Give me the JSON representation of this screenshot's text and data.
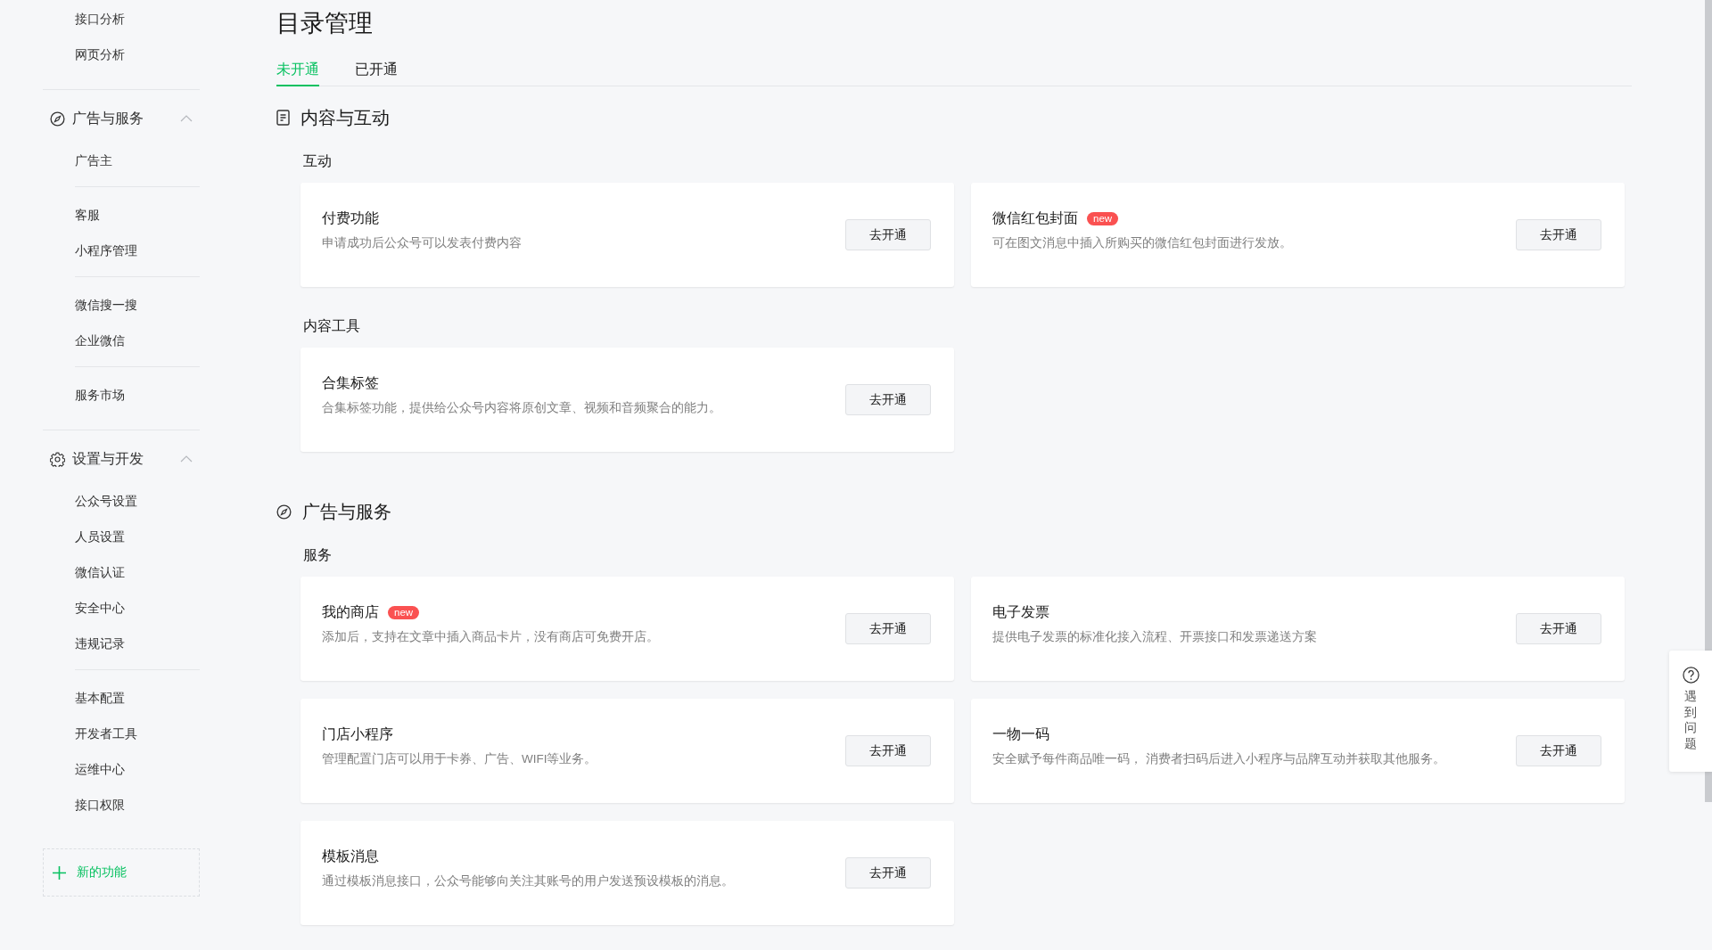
{
  "sidebar": {
    "sections": [
      {
        "groups": [
          [
            "接口分析",
            "网页分析"
          ]
        ]
      },
      {
        "title": "广告与服务",
        "expanded": true,
        "groups": [
          [
            "广告主"
          ],
          [
            "客服",
            "小程序管理"
          ],
          [
            "微信搜一搜",
            "企业微信"
          ],
          [
            "服务市场"
          ]
        ]
      },
      {
        "title": "设置与开发",
        "expanded": true,
        "groups": [
          [
            "公众号设置",
            "人员设置",
            "微信认证",
            "安全中心",
            "违规记录"
          ],
          [
            "基本配置",
            "开发者工具",
            "运维中心",
            "接口权限"
          ]
        ]
      }
    ],
    "add_button": "新的功能"
  },
  "page": {
    "title": "目录管理",
    "tabs": [
      {
        "label": "未开通",
        "selected": true
      },
      {
        "label": "已开通",
        "selected": false
      }
    ],
    "sections": [
      {
        "title": "内容与互动",
        "groups": [
          {
            "title": "互动",
            "cards": [
              {
                "title": "付费功能",
                "description": "申请成功后公众号可以发表付费内容",
                "button": "去开通"
              },
              {
                "title": "微信红包封面",
                "badge": "new",
                "description": "可在图文消息中插入所购买的微信红包封面进行发放。",
                "button": "去开通"
              }
            ]
          },
          {
            "title": "内容工具",
            "cards": [
              {
                "title": "合集标签",
                "description": "合集标签功能，提供给公众号内容将原创文章、视频和音频聚合的能力。",
                "button": "去开通"
              }
            ]
          }
        ]
      },
      {
        "title": "广告与服务",
        "groups": [
          {
            "title": "服务",
            "cards": [
              {
                "title": "我的商店",
                "badge": "new",
                "description": "添加后，支持在文章中插入商品卡片，没有商店可免费开店。",
                "button": "去开通"
              },
              {
                "title": "电子发票",
                "description": "提供电子发票的标准化接入流程、开票接口和发票递送方案",
                "button": "去开通"
              },
              {
                "title": "门店小程序",
                "description": "管理配置门店可以用于卡券、广告、WIFI等业务。",
                "button": "去开通"
              },
              {
                "title": "一物一码",
                "description": "安全赋予每件商品唯一码， 消费者扫码后进入小程序与品牌互动并获取其他服务。",
                "button": "去开通"
              },
              {
                "title": "模板消息",
                "description": "通过模板消息接口，公众号能够向关注其账号的用户发送预设模板的消息。",
                "button": "去开通"
              }
            ]
          }
        ]
      }
    ]
  },
  "help": {
    "label": "遇到问题"
  }
}
